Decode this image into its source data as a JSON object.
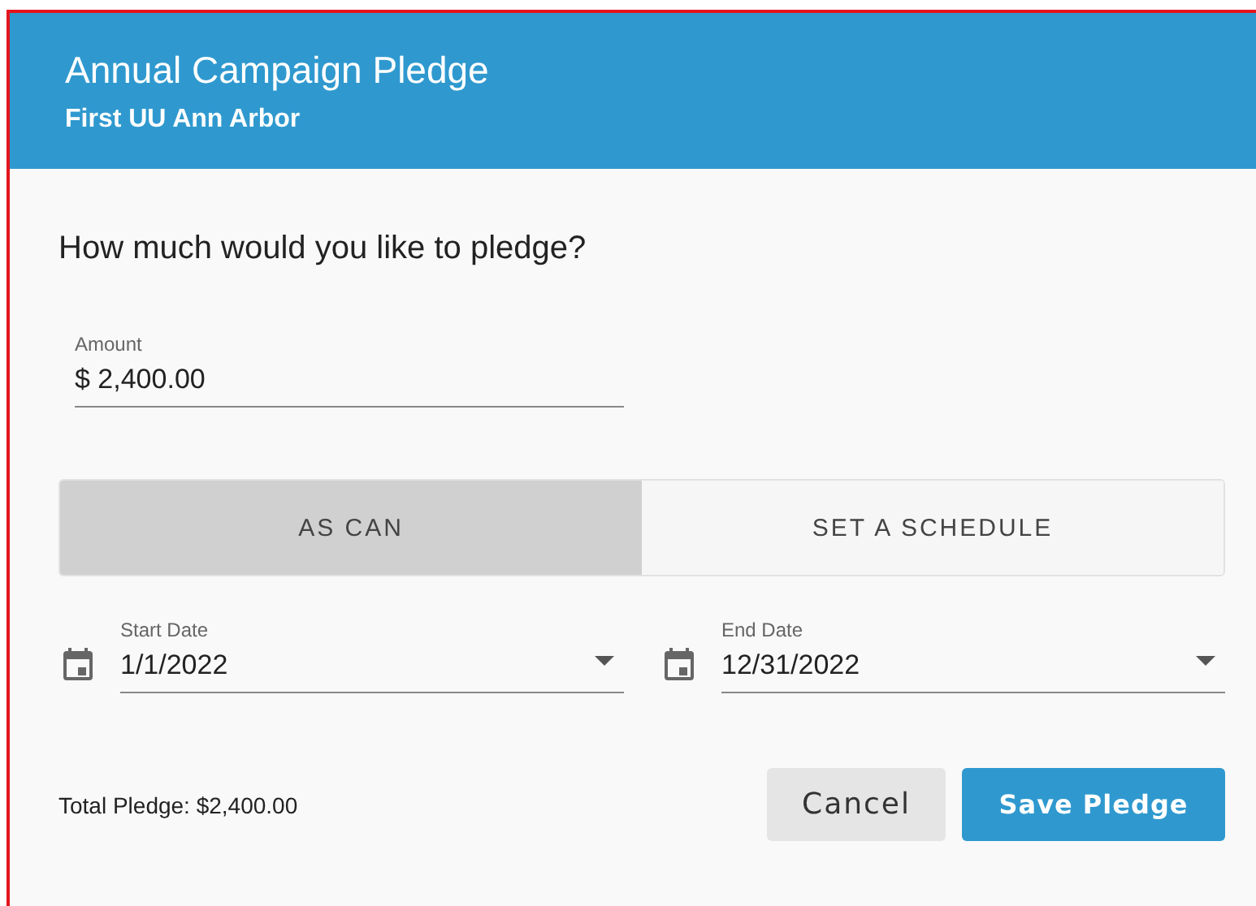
{
  "header": {
    "title": "Annual Campaign Pledge",
    "subtitle": "First UU Ann Arbor"
  },
  "question": "How much would you like to pledge?",
  "amount": {
    "label": "Amount",
    "value": "$ 2,400.00"
  },
  "modes": [
    {
      "label": "AS CAN",
      "selected": true
    },
    {
      "label": "SET A SCHEDULE",
      "selected": false
    }
  ],
  "dates": [
    {
      "label": "Start Date",
      "value": "1/1/2022"
    },
    {
      "label": "End Date",
      "value": "12/31/2022"
    }
  ],
  "total": "Total Pledge: $2,400.00",
  "buttons": [
    {
      "label": "Cancel",
      "kind": "secondary"
    },
    {
      "label": "Save Pledge",
      "kind": "primary"
    }
  ]
}
